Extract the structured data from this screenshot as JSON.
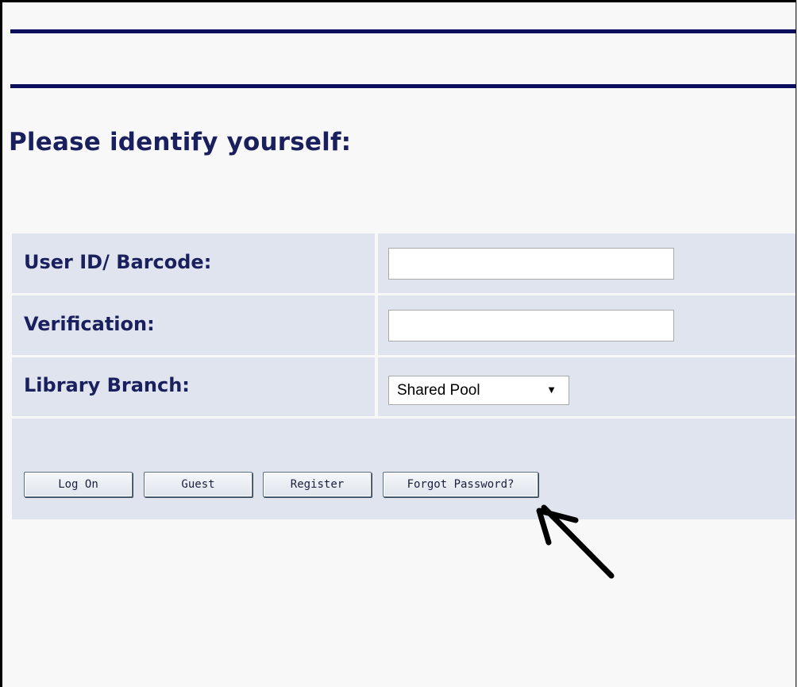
{
  "page": {
    "title": "Please identify yourself:"
  },
  "form": {
    "user_id_label": "User ID/ Barcode:",
    "user_id_value": "",
    "verification_label": "Verification:",
    "verification_value": "",
    "branch_label": "Library Branch:",
    "branch_selected": "Shared Pool"
  },
  "buttons": {
    "log_on": "Log On",
    "guest": "Guest",
    "register": "Register",
    "forgot_password": "Forgot Password?"
  },
  "colors": {
    "heading_text": "#1a1f5e",
    "rule": "#0b0f5c",
    "panel_background": "#dfe4ee",
    "annotation_arrow": "#000000"
  },
  "icons": {
    "select_arrow": "triangle-down",
    "annotation": "hand-drawn-arrow"
  }
}
